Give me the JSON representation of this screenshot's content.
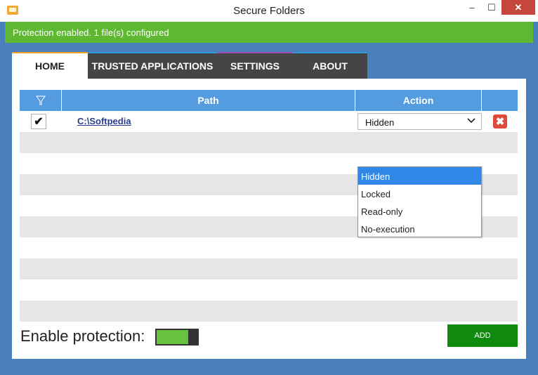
{
  "window": {
    "title": "Secure Folders",
    "minimize_glyph": "–",
    "maximize_glyph": "☐",
    "close_glyph": "✕"
  },
  "status": {
    "text": "Protection enabled. 1 file(s) configured",
    "color": "#5fb832"
  },
  "tabs": [
    {
      "label": "HOME",
      "active": true
    },
    {
      "label": "TRUSTED APPLICATIONS",
      "active": false
    },
    {
      "label": "SETTINGS",
      "active": false
    },
    {
      "label": "ABOUT",
      "active": false
    }
  ],
  "table": {
    "columns": [
      "",
      "Path",
      "Action",
      ""
    ],
    "rows": [
      {
        "checked": true,
        "check_glyph": "✔",
        "path": "C:\\Softpedia",
        "action": "Hidden",
        "delete_glyph": "✖"
      }
    ],
    "empty_rows": 9
  },
  "dropdown": {
    "options": [
      "Hidden",
      "Locked",
      "Read-only",
      "No-execution"
    ],
    "selected": "Hidden"
  },
  "footer": {
    "enable_label": "Enable protection:",
    "toggle_on": true,
    "add_label": "ADD"
  },
  "colors": {
    "accent": "#559be0",
    "background": "#4a7fbd",
    "add_button": "#0f8a0f",
    "delete": "#e04a3a"
  },
  "icons": {
    "app": "secure-folders-icon",
    "filter": "filter-icon",
    "chevron": "chevron-down-icon",
    "delete": "close-icon"
  }
}
